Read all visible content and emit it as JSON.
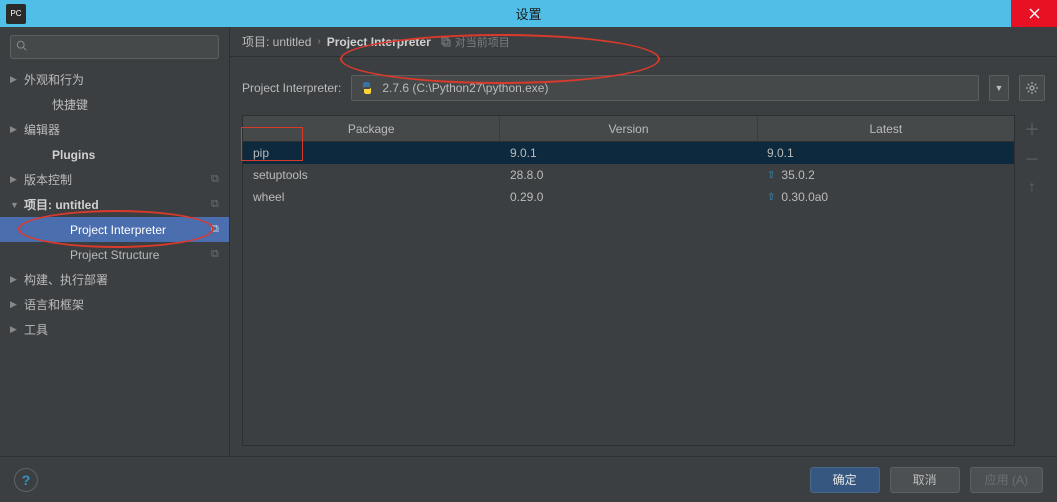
{
  "window": {
    "title": "设置",
    "app_abbrev": "PC"
  },
  "sidebar": {
    "search_placeholder": "",
    "items": [
      {
        "label": "外观和行为",
        "arrow": "▶",
        "bold": false
      },
      {
        "label": "快捷键",
        "arrow": "",
        "bold": false,
        "child": true
      },
      {
        "label": "编辑器",
        "arrow": "▶",
        "bold": false
      },
      {
        "label": "Plugins",
        "arrow": "",
        "bold": true,
        "child": true
      },
      {
        "label": "版本控制",
        "arrow": "▶",
        "bold": false,
        "copy": true
      },
      {
        "label": "项目: untitled",
        "arrow": "▼",
        "bold": true,
        "copy": true
      },
      {
        "label": "Project Interpreter",
        "arrow": "",
        "grandchild": true,
        "selected": true,
        "copy": true
      },
      {
        "label": "Project Structure",
        "arrow": "",
        "grandchild": true,
        "copy": true
      },
      {
        "label": "构建、执行部署",
        "arrow": "▶",
        "bold": false
      },
      {
        "label": "语言和框架",
        "arrow": "▶",
        "bold": false
      },
      {
        "label": "工具",
        "arrow": "▶",
        "bold": false
      }
    ]
  },
  "breadcrumb": {
    "part1": "项目: untitled",
    "part2": "Project Interpreter",
    "hint": "对当前项目"
  },
  "interpreter": {
    "label": "Project Interpreter:",
    "value": "2.7.6 (C:\\Python27\\python.exe)"
  },
  "packages": {
    "headers": {
      "package": "Package",
      "version": "Version",
      "latest": "Latest"
    },
    "rows": [
      {
        "name": "pip",
        "version": "9.0.1",
        "latest": "9.0.1",
        "upgrade": false,
        "selected": true
      },
      {
        "name": "setuptools",
        "version": "28.8.0",
        "latest": "35.0.2",
        "upgrade": true
      },
      {
        "name": "wheel",
        "version": "0.29.0",
        "latest": "0.30.0a0",
        "upgrade": true
      }
    ]
  },
  "footer": {
    "ok": "确定",
    "cancel": "取消",
    "apply": "应用 (A)"
  }
}
